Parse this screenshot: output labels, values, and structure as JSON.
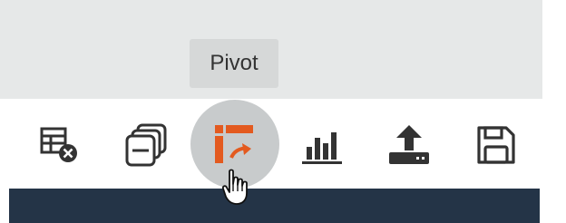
{
  "tooltip": {
    "text": "Pivot"
  },
  "toolbar": {
    "tools": [
      {
        "name": "table-remove",
        "icon": "table-remove-icon"
      },
      {
        "name": "collapse-layers",
        "icon": "layers-minus-icon"
      },
      {
        "name": "pivot",
        "icon": "pivot-icon",
        "active": true
      },
      {
        "name": "chart",
        "icon": "bar-chart-icon"
      },
      {
        "name": "export",
        "icon": "upload-icon"
      },
      {
        "name": "save",
        "icon": "floppy-disk-icon"
      }
    ]
  },
  "colors": {
    "icon": "#333333",
    "pivot_accent": "#e35a1f",
    "header_band": "#e6e8e8",
    "dark_bar": "#243447",
    "tooltip_bg": "#d6d8d8",
    "highlight": "#c8cbcc"
  }
}
